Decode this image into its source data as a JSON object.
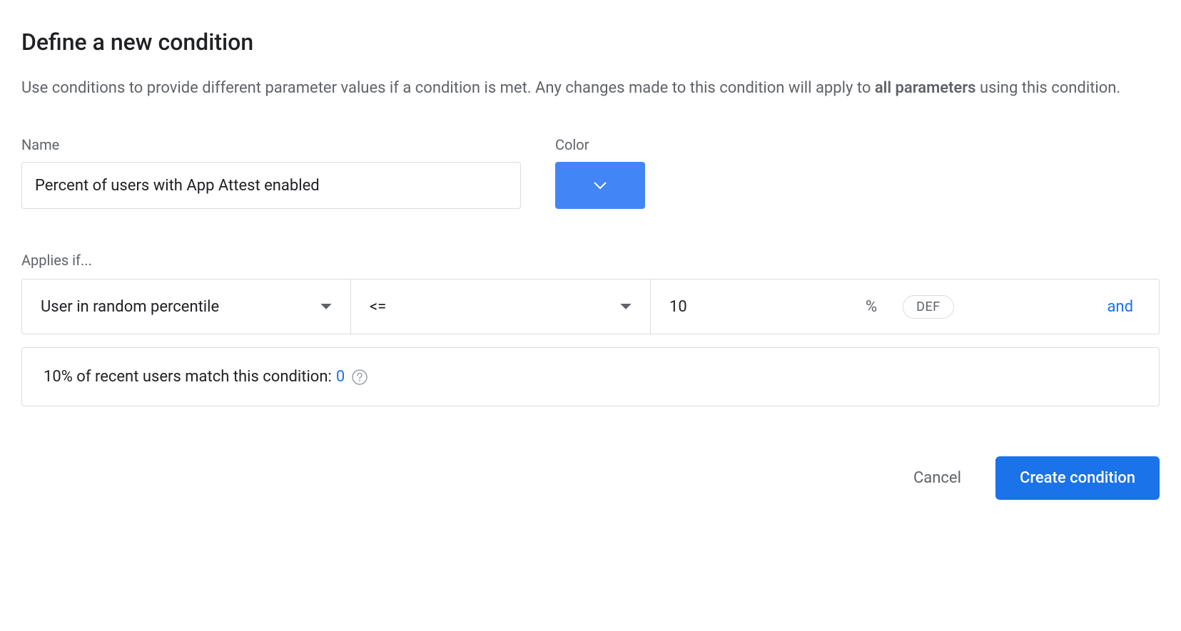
{
  "title": "Define a new condition",
  "description": {
    "before": "Use conditions to provide different parameter values if a condition is met. Any changes made to this condition will apply to ",
    "bold": "all parameters",
    "after": " using this condition."
  },
  "fields": {
    "name_label": "Name",
    "name_value": "Percent of users with App Attest enabled",
    "color_label": "Color",
    "color_value": "#4285f4"
  },
  "applies": {
    "label": "Applies if...",
    "attribute": "User in random percentile",
    "operator": "<=",
    "value": "10",
    "unit": "%",
    "chip": "DEF",
    "and_label": "and"
  },
  "match_info": {
    "text": "10% of recent users match this condition: ",
    "count": "0"
  },
  "actions": {
    "cancel": "Cancel",
    "create": "Create condition"
  }
}
